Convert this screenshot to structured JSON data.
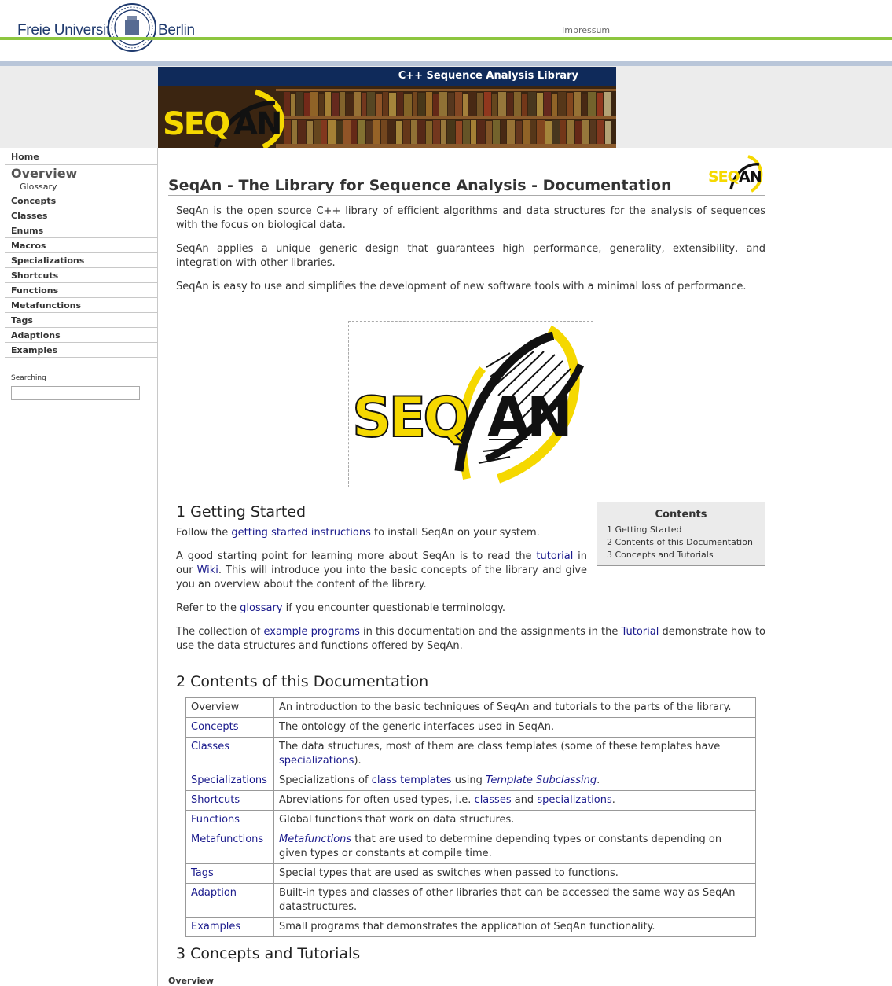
{
  "header": {
    "fu_left": "Freie Universität",
    "fu_right": "Berlin",
    "impressum": "Impressum"
  },
  "banner": {
    "title": "C++ Sequence Analysis Library",
    "logo_text": "SEQAN"
  },
  "sidebar": {
    "home": "Home",
    "overview": "Overview",
    "glossary": "Glossary",
    "items": [
      "Concepts",
      "Classes",
      "Enums",
      "Macros",
      "Specializations",
      "Shortcuts",
      "Functions",
      "Metafunctions",
      "Tags",
      "Adaptions",
      "Examples"
    ],
    "search_label": "Searching"
  },
  "main": {
    "title": "SeqAn - The Library for Sequence Analysis - Documentation",
    "intro": [
      "SeqAn is the open source C++ library of efficient algorithms and data structures for the analysis of sequences with the focus on biological data.",
      "SeqAn applies a unique generic design that guarantees high performance, generality, extensibility, and integration with other libraries.",
      "SeqAn is easy to use and simplifies the development of new software tools with a minimal loss of performance."
    ],
    "big_logo_text": "SEQAN",
    "section1": {
      "heading": "1 Getting Started",
      "p1_a": "Follow the ",
      "p1_link": "getting started instructions",
      "p1_b": " to install SeqAn on your system.",
      "p2_a": "A good starting point for learning more about SeqAn is to read the ",
      "p2_link1": "tutorial",
      "p2_b": " in our ",
      "p2_link2": "Wiki",
      "p2_c": ". This will introduce you into the basic concepts of the library and give you an overview about the content of the library.",
      "p3_a": "Refer to the ",
      "p3_link": "glossary",
      "p3_b": " if you encounter questionable terminology.",
      "p4_a": "The collection of ",
      "p4_link1": "example programs",
      "p4_b": " in this documentation and the assignments in the ",
      "p4_link2": "Tutorial",
      "p4_c": " demonstrate how to use the data structures and functions offered by SeqAn."
    },
    "toc": {
      "title": "Contents",
      "items": [
        "1 Getting Started",
        "2 Contents of this Documentation",
        "3 Concepts and Tutorials"
      ]
    },
    "section2": {
      "heading": "2 Contents of this Documentation",
      "rows": [
        {
          "key": "Overview",
          "desc": "An introduction to the basic techniques of SeqAn and tutorials to the parts of the library."
        },
        {
          "key": "Concepts",
          "desc": "The ontology of the generic interfaces used in SeqAn."
        },
        {
          "key": "Classes",
          "desc_a": "The data structures, most of them are class templates (some of these templates have ",
          "desc_link": "specializations",
          "desc_b": ")."
        },
        {
          "key": "Specializations",
          "desc_a": "Specializations of ",
          "desc_link": "class templates",
          "desc_b": " using ",
          "desc_em": "Template Subclassing",
          "desc_c": "."
        },
        {
          "key": "Shortcuts",
          "desc_a": "Abreviations for often used types, i.e. ",
          "desc_link": "classes",
          "desc_b": " and ",
          "desc_link2": "specializations",
          "desc_c": "."
        },
        {
          "key": "Functions",
          "desc": "Global functions that work on data structures."
        },
        {
          "key": "Metafunctions",
          "desc_em": "Metafunctions",
          "desc": " that are used to determine depending types or constants depending on given types or constants at compile time."
        },
        {
          "key": "Tags",
          "desc": "Special types that are used as switches when passed to functions."
        },
        {
          "key": "Adaption",
          "desc": "Built-in types and classes of other libraries that can be accessed the same way as SeqAn datastructures."
        },
        {
          "key": "Examples",
          "desc": "Small programs that demonstrates the application of SeqAn functionality."
        }
      ]
    },
    "section3": {
      "heading": "3 Concepts and Tutorials",
      "sub": "Overview"
    }
  },
  "colors": {
    "green_line": "#8dc63f",
    "blue_line": "#b9c6d9",
    "banner_bg": "#0f2a5a",
    "link": "#1a1a8c",
    "logo_yellow": "#f5d800"
  }
}
